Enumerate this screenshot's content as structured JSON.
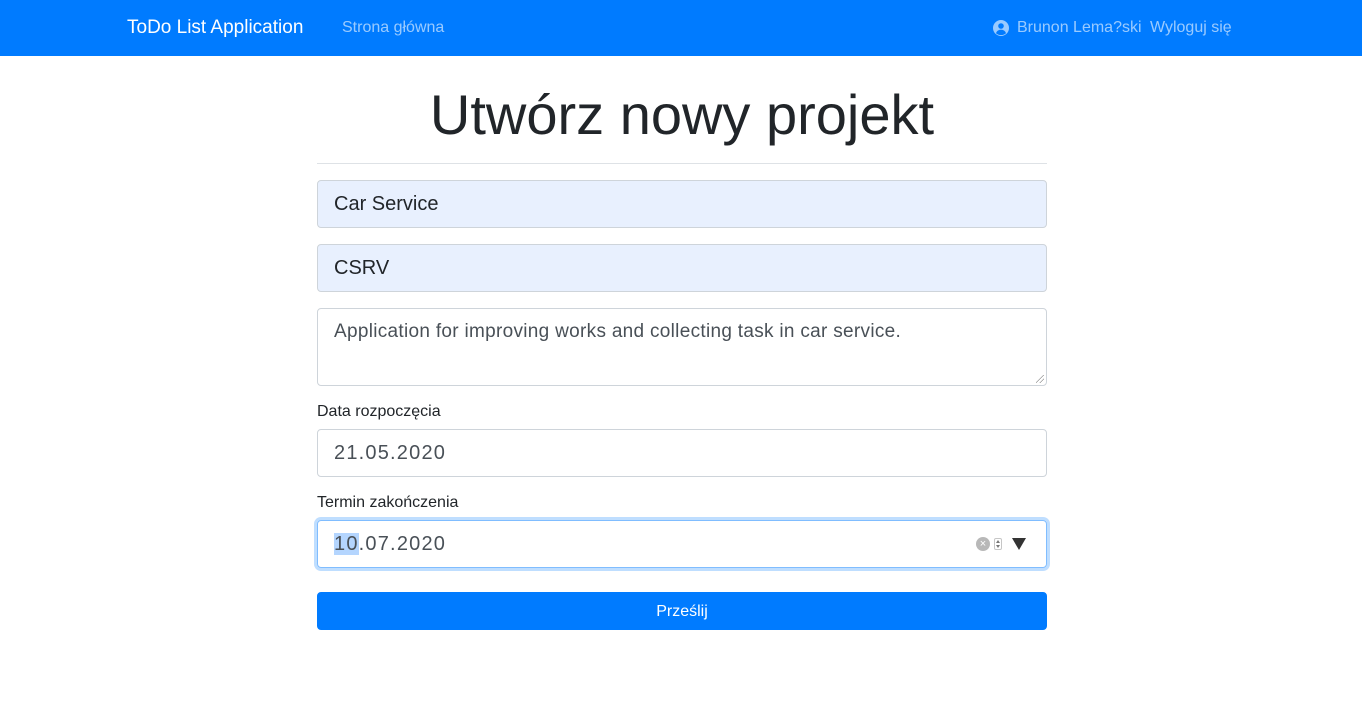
{
  "navbar": {
    "brand": "ToDo List Application",
    "home_link": "Strona główna",
    "user_name": "Brunon Lema?ski",
    "logout_link": "Wyloguj się",
    "bg_color": "#007bff"
  },
  "page": {
    "title": "Utwórz nowy projekt"
  },
  "form": {
    "name_value": "Car Service",
    "key_value": "CSRV",
    "description_value": "Application for improving works and collecting task in car service.",
    "start_date_label": "Data rozpoczęcia",
    "start_date_value": "21.05.2020",
    "end_date_label": "Termin zakończenia",
    "end_date_day": "10",
    "end_date_rest": ".07.2020",
    "submit_label": "Prześlij"
  },
  "icons": {
    "user": "user-circle-icon",
    "clear": "clear-icon",
    "spinner": "spinner-icon",
    "dropdown": "dropdown-arrow-icon"
  }
}
